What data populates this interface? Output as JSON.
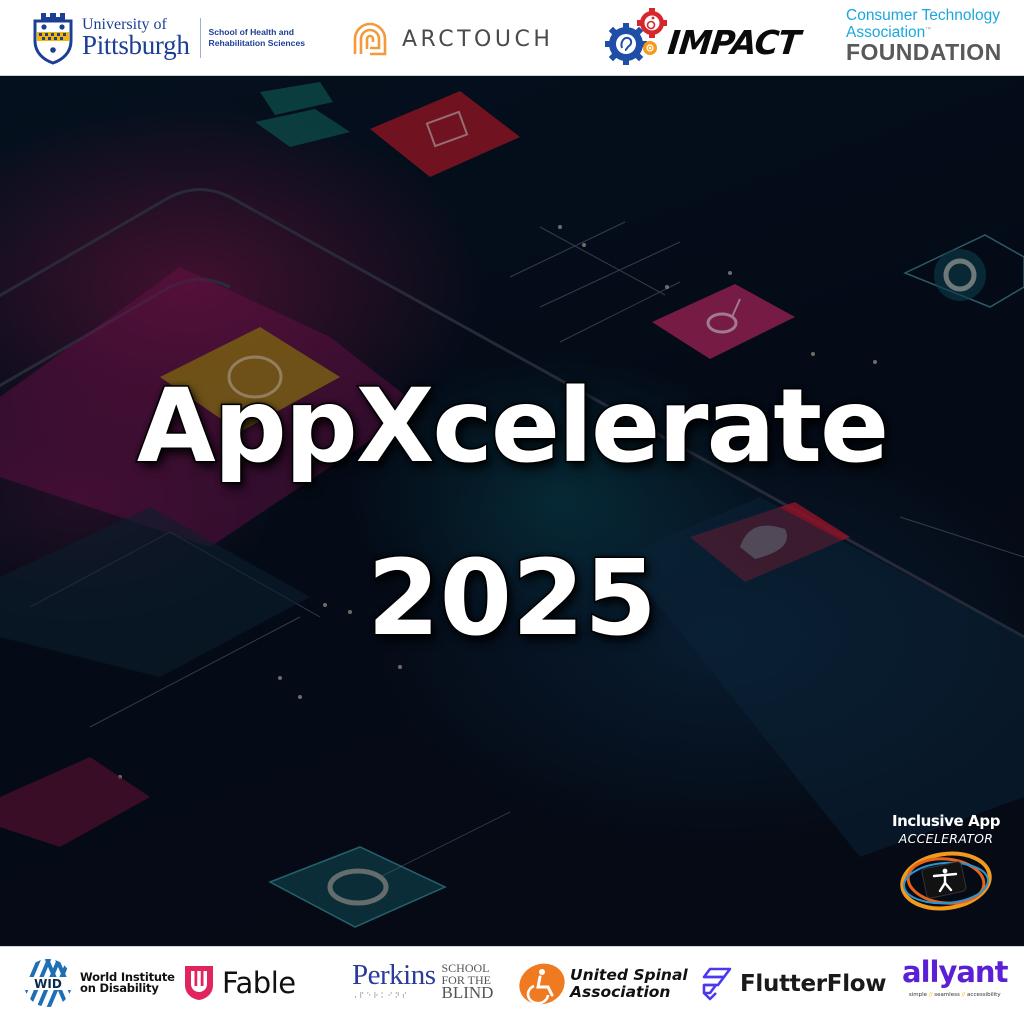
{
  "header": {
    "sponsors": {
      "pitt": {
        "line1": "University of",
        "line2": "Pittsburgh",
        "school_line1": "School of Health and",
        "school_line2": "Rehabilitation Sciences"
      },
      "arctouch": {
        "name": "ARCTOUCH"
      },
      "impact": {
        "name": "IMPACT"
      },
      "cta_foundation": {
        "line1": "Consumer Technology",
        "line2": "Association",
        "trademark": "™",
        "line3": "FOUNDATION"
      }
    }
  },
  "hero": {
    "title_line1": "AppXcelerate",
    "title_line2": "2025",
    "badge": {
      "line1": "Inclusive App",
      "line2": "ACCELERATOR"
    }
  },
  "footer": {
    "partners": {
      "wid": {
        "abbr": "WID",
        "line1": "World Institute",
        "line2": "on Disability"
      },
      "fable": {
        "name": "Fable"
      },
      "perkins": {
        "name": "Perkins",
        "braille": "⠠⠏⠑⠗⠅⠊⠝⠎",
        "school_line1": "SCHOOL",
        "school_line2": "FOR THE",
        "school_line3": "BLIND"
      },
      "united_spinal": {
        "line1": "United Spinal",
        "line2": "Association"
      },
      "flutterflow": {
        "name": "FlutterFlow"
      },
      "allyant": {
        "name": "allyant",
        "tag1": "simple",
        "tag2": "seamless",
        "tag3": "accessibility",
        "sep": "//"
      }
    }
  },
  "colors": {
    "pitt_blue": "#1c3f94",
    "pitt_gold": "#f2b705",
    "arctouch_orange": "#f39a3b",
    "cta_blue": "#1aa7dd",
    "fable_pink": "#e0245e",
    "perkins_blue": "#2b3b9c",
    "united_spinal_orange": "#f07a22",
    "flutterflow_purple": "#4b39ef",
    "allyant_purple": "#5b1fd6",
    "hero_background": "#040b17"
  }
}
